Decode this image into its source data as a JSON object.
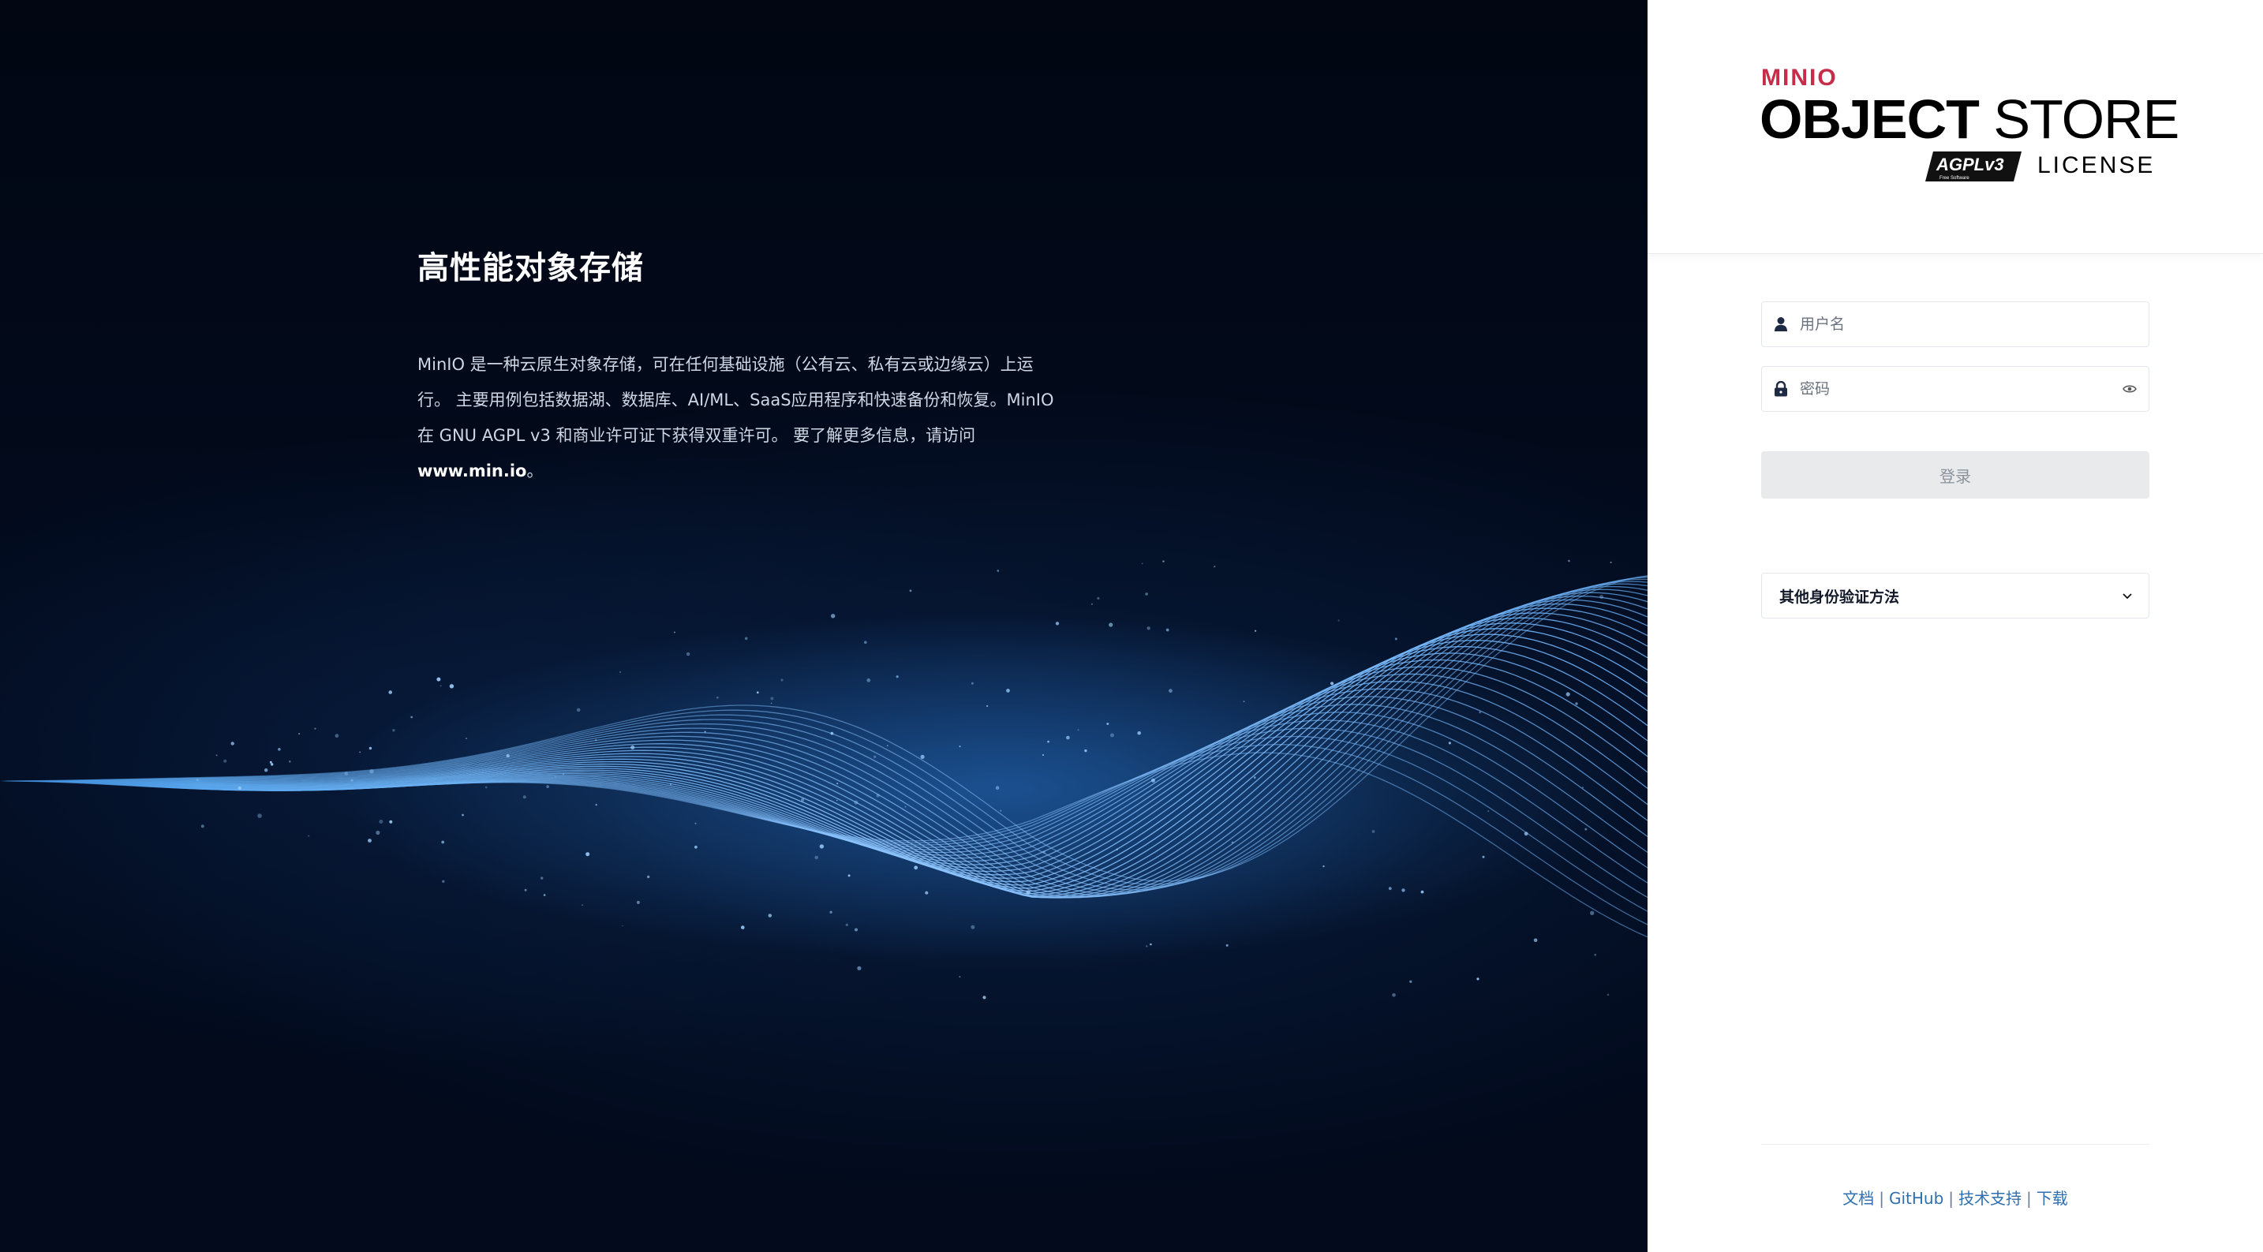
{
  "hero": {
    "title": "高性能对象存储",
    "description_line1": "MinIO 是一种云原生对象存储，可在任何基础设施（公有云、私有云或边缘云）上运",
    "description_line2": "行。 主要用例包括数据湖、数据库、AI/ML、SaaS应用程序和快速备份和恢复。MinIO",
    "description_line3": "在 GNU AGPL v3 和商业许可证下获得双重许可。 要了解更多信息，请访问",
    "link_text": "www.min.io",
    "link_suffix": "。"
  },
  "logo": {
    "brand": "MINIO",
    "product_strong": "OBJECT",
    "product_light": "STORE",
    "badge": "AGPLv3",
    "badge_sub": "Free Software",
    "license": "LICENSE"
  },
  "login": {
    "username_placeholder": "用户名",
    "password_placeholder": "密码",
    "submit_label": "登录",
    "alt_auth_label": "其他身份验证方法"
  },
  "footer": {
    "docs": "文档",
    "github": "GitHub",
    "support": "技术支持",
    "download": "下载",
    "separator": "|"
  },
  "colors": {
    "brand_red": "#c72c48",
    "link_blue": "#2f6fb0",
    "hero_bg": "#020b1e"
  }
}
